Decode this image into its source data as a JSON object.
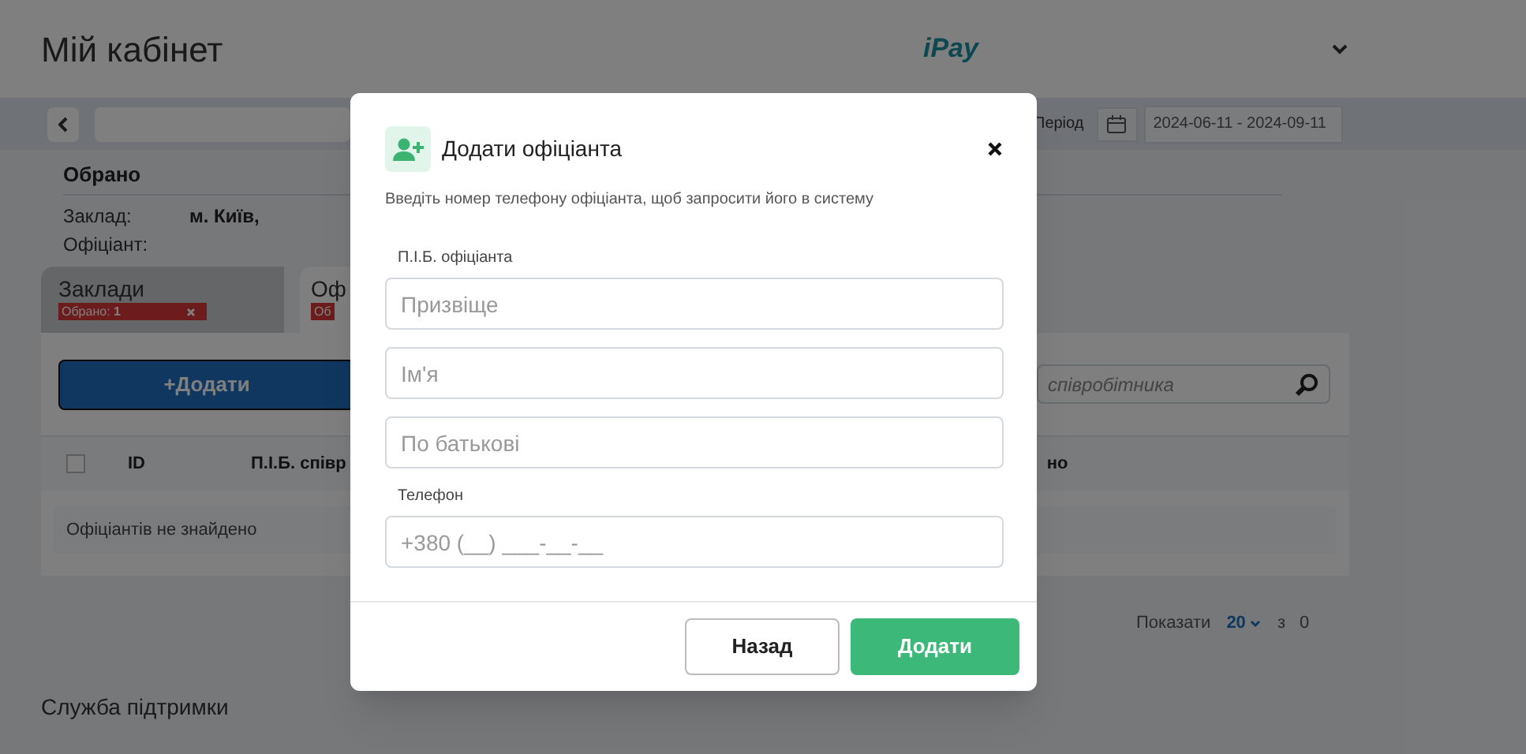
{
  "header": {
    "title": "Мій кабінет",
    "logo": "iPay"
  },
  "filter_bar": {
    "period_label": "Період",
    "date_range": "2024-06-11 - 2024-09-11"
  },
  "selection": {
    "title": "Обрано",
    "venue_label": "Заклад:",
    "venue_value": "м. Київ,",
    "waiter_label": "Офіціант:"
  },
  "tabs": [
    {
      "label": "Заклади",
      "badge": "Обрано: **1**",
      "selected": false
    },
    {
      "label": "Оф",
      "badge": "Об",
      "selected": true
    }
  ],
  "add_button": "+Додати",
  "search": {
    "placeholder": "співробітника"
  },
  "table": {
    "select_all_checked": false,
    "columns": [
      "ID",
      "П.І.Б. співр",
      "но"
    ],
    "empty_message": "Офіціантів не знайдено"
  },
  "pagination": {
    "label": "Показати",
    "page_size": "20",
    "of_label": "з",
    "total": "0"
  },
  "footer": "Служба підтримки",
  "modal": {
    "title": "Додати офіціанта",
    "description": "Введіть номер телефону офіціанта, щоб запросити його в систему",
    "fields": [
      {
        "label": "П.І.Б. офіціанта",
        "placeholder": "Призвіще"
      },
      {
        "placeholder": "Ім'я"
      },
      {
        "placeholder": "По батькові"
      },
      {
        "label": "Телефон",
        "placeholder": "+380 (__) ___-__-__"
      }
    ],
    "buttons": [
      {
        "label": "Назад",
        "kind": "secondary"
      },
      {
        "label": "Додати",
        "kind": "primary"
      }
    ]
  }
}
